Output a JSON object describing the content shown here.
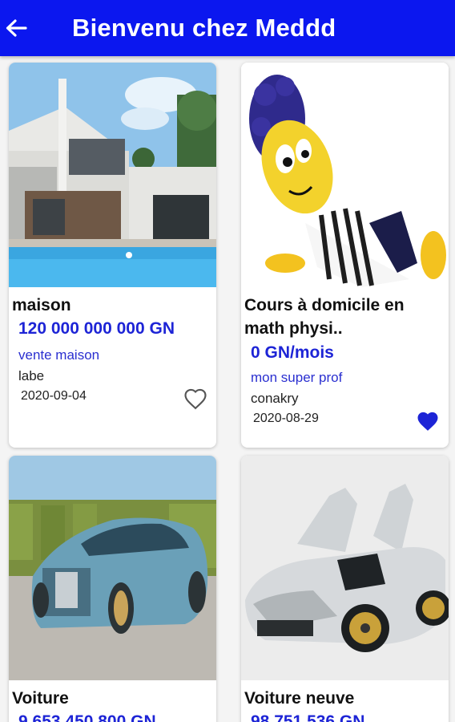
{
  "appbar": {
    "title": "Bienvenu chez Meddd",
    "back_icon": "arrow-back-icon",
    "background": "#0b17ef"
  },
  "listings": [
    {
      "title": "maison",
      "price": "120 000 000 000 GN",
      "category": "vente maison",
      "location": "labe",
      "date": "2020-09-04",
      "favorite": false,
      "image": "modern-house-with-pool"
    },
    {
      "title": "Cours à domicile en math physi..",
      "price": "0 GN/mois",
      "category": "mon super prof",
      "location": "conakry",
      "date": "2020-08-29",
      "favorite": true,
      "image": "cartoon-character"
    },
    {
      "title": "Voiture",
      "price": "9 653 450 800 GN",
      "image": "concept-car"
    },
    {
      "title": "Voiture neuve",
      "price": "98 751 536 GN",
      "image": "sports-car-open-doors"
    }
  ],
  "colors": {
    "accent": "#0b17ef",
    "price": "#1d24d6",
    "favorite": "#1d24d6"
  }
}
